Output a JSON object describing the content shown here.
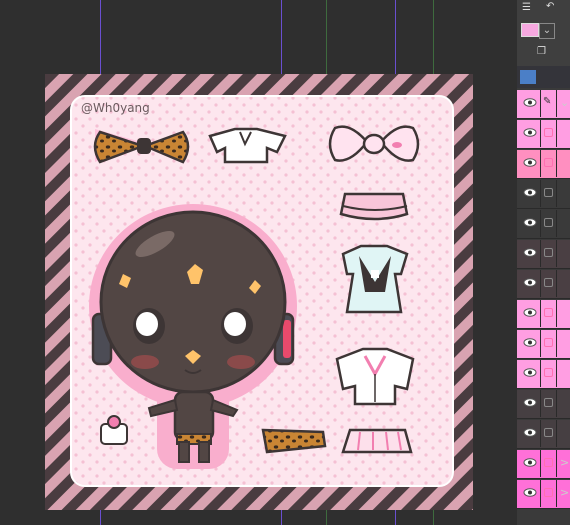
{
  "artwork": {
    "watermark": "@Wh0yang",
    "colors": {
      "stripe_dark": "#4a3c40",
      "stripe_pink": "#d9a3b1",
      "sticker_bg": "#fde6ee",
      "sticker_outline": "#f9aecd",
      "dots": "#f5c0d3",
      "skin": "#524644",
      "leopard": "#b8752c",
      "line": "#3d3535"
    },
    "stickers": [
      "leopard-bow",
      "white-crop-top",
      "pink-hair-bow",
      "pink-ruffle-skirt",
      "maid-dress",
      "white-blouse",
      "leopard-bandeau",
      "pink-pleated-skirt",
      "cake"
    ]
  },
  "toolbar": {
    "menu_icon": "menu-icon",
    "undo_icon": "undo-icon",
    "color_swatch": "#f7a8e0",
    "dropdown_icon": "chevron-down-icon"
  },
  "layers": [
    {
      "color": "#ff9ee2",
      "visible": true,
      "checkbox": "pen",
      "arrow": "⌄"
    },
    {
      "color": "#ff9ee2",
      "visible": true,
      "checkbox": "pink",
      "arrow": ""
    },
    {
      "color": "#ff8fc0",
      "visible": true,
      "checkbox": "pink",
      "arrow": ""
    },
    {
      "color": "#3a3a3a",
      "visible": true,
      "checkbox": "gray",
      "arrow": ""
    },
    {
      "color": "#3a3a3a",
      "visible": true,
      "checkbox": "gray",
      "arrow": ""
    },
    {
      "color": "#4a3f43",
      "visible": true,
      "checkbox": "gray",
      "arrow": ""
    },
    {
      "color": "#4a3f43",
      "visible": true,
      "checkbox": "gray",
      "arrow": ""
    },
    {
      "color": "#ff9ee2",
      "visible": true,
      "checkbox": "pink",
      "arrow": ""
    },
    {
      "color": "#ff9ee2",
      "visible": true,
      "checkbox": "pink",
      "arrow": ""
    },
    {
      "color": "#ff9ee2",
      "visible": true,
      "checkbox": "pink",
      "arrow": ""
    },
    {
      "color": "#463f42",
      "visible": true,
      "checkbox": "gray",
      "arrow": ""
    },
    {
      "color": "#463f42",
      "visible": true,
      "checkbox": "gray",
      "arrow": ""
    },
    {
      "color": "#ff70d8",
      "visible": true,
      "checkbox": "pink",
      "arrow": ">"
    },
    {
      "color": "#ff70d8",
      "visible": true,
      "checkbox": "pink",
      "arrow": ">"
    }
  ]
}
